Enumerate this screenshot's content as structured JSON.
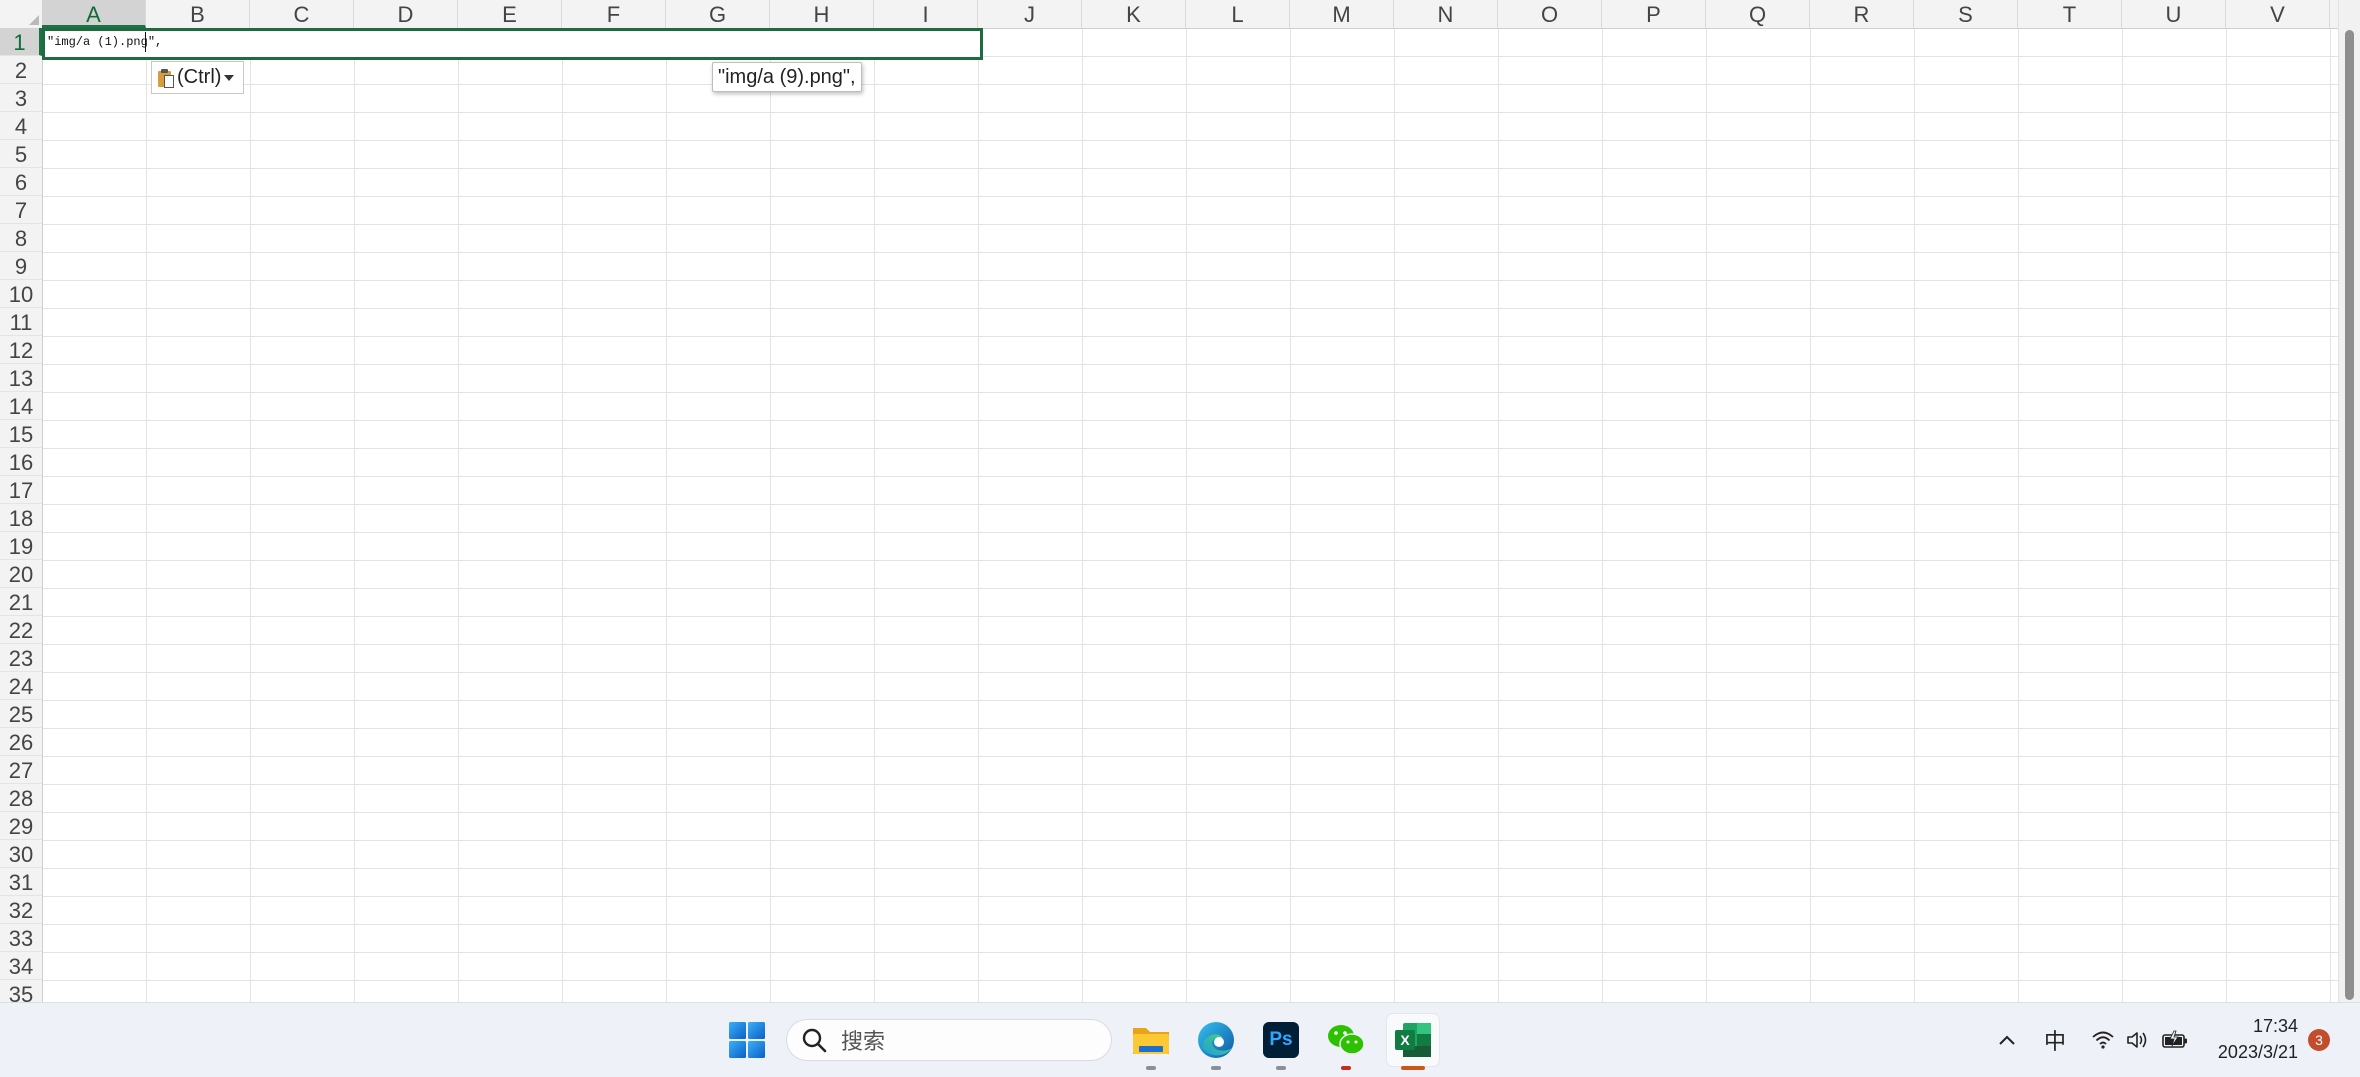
{
  "spreadsheet": {
    "columns": [
      "A",
      "B",
      "C",
      "D",
      "E",
      "F",
      "G",
      "H",
      "I",
      "J",
      "K",
      "L",
      "M",
      "N",
      "O",
      "P",
      "Q",
      "R",
      "S",
      "T",
      "U",
      "V"
    ],
    "rows": [
      "1",
      "2",
      "3",
      "4",
      "5",
      "6",
      "7",
      "8",
      "9",
      "10",
      "11",
      "12",
      "13",
      "14",
      "15",
      "16",
      "17",
      "18",
      "19",
      "20",
      "21",
      "22",
      "23",
      "24",
      "25",
      "26",
      "27",
      "28",
      "29",
      "30",
      "31",
      "32",
      "33",
      "34",
      "35"
    ],
    "selected_column": "A",
    "selected_row": "1",
    "active_cell_text": "\"img/a (1).png\",",
    "paste_options_label": "(Ctrl)",
    "autocomplete_tooltip": "\"img/a (9).png\","
  },
  "taskbar": {
    "search_placeholder": "搜索",
    "apps": [
      {
        "name": "start",
        "icon": "windows-start-icon"
      },
      {
        "name": "file-explorer",
        "icon": "folder-icon"
      },
      {
        "name": "edge",
        "icon": "edge-browser-icon"
      },
      {
        "name": "photoshop",
        "icon": "photoshop-icon",
        "label": "Ps"
      },
      {
        "name": "wechat",
        "icon": "wechat-icon"
      },
      {
        "name": "excel",
        "icon": "excel-icon",
        "label": "X"
      }
    ],
    "ime_label": "中",
    "time": "17:34",
    "date": "2023/3/21",
    "notification_count": "3"
  },
  "colors": {
    "selection_green": "#1e6b41",
    "excel_green": "#1d7044",
    "photoshop_bg": "#001e36",
    "photoshop_text": "#31a8ff",
    "windows_blue": "#0a74da"
  }
}
